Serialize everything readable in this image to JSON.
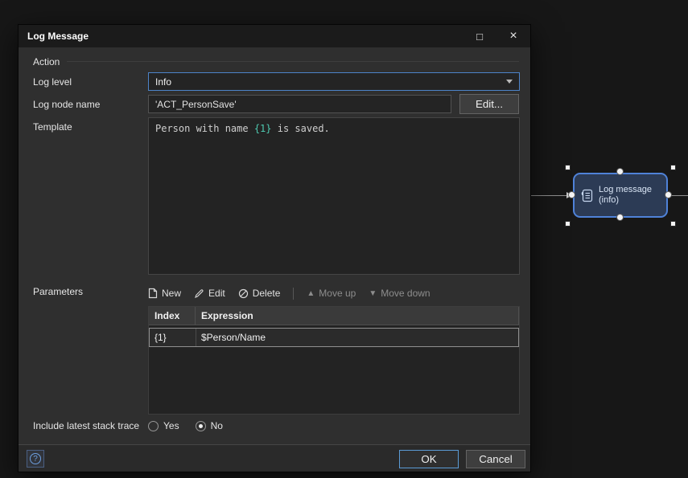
{
  "window": {
    "title": "Log Message"
  },
  "icons": {
    "maximize": "□",
    "close": "×",
    "move_up": "▲",
    "move_down": "▼",
    "help": "?"
  },
  "action_group": {
    "label": "Action"
  },
  "fields": {
    "log_level": {
      "label": "Log level",
      "value": "Info"
    },
    "log_node_name": {
      "label": "Log node name",
      "value": "'ACT_PersonSave'",
      "edit_button_label": "Edit..."
    },
    "template": {
      "label": "Template",
      "text_before": "Person with name ",
      "token": "{1}",
      "text_after": " is saved."
    }
  },
  "parameters": {
    "label": "Parameters",
    "toolbar": {
      "new_label": "New",
      "edit_label": "Edit",
      "delete_label": "Delete",
      "move_up_label": "Move up",
      "move_down_label": "Move down"
    },
    "table": {
      "columns": [
        "Index",
        "Expression"
      ],
      "rows": [
        {
          "index": "{1}",
          "expression": "$Person/Name"
        }
      ]
    }
  },
  "stack_trace": {
    "label": "Include latest stack trace",
    "options": [
      "Yes",
      "No"
    ],
    "selected": "No"
  },
  "footer": {
    "ok_label": "OK",
    "cancel_label": "Cancel"
  },
  "canvas": {
    "node": {
      "title": "Log message",
      "subtitle": "(info)"
    }
  },
  "colors": {
    "accent_blue": "#4d84c9",
    "node_border": "#4f82d8",
    "token_teal": "#4ec9b0"
  }
}
